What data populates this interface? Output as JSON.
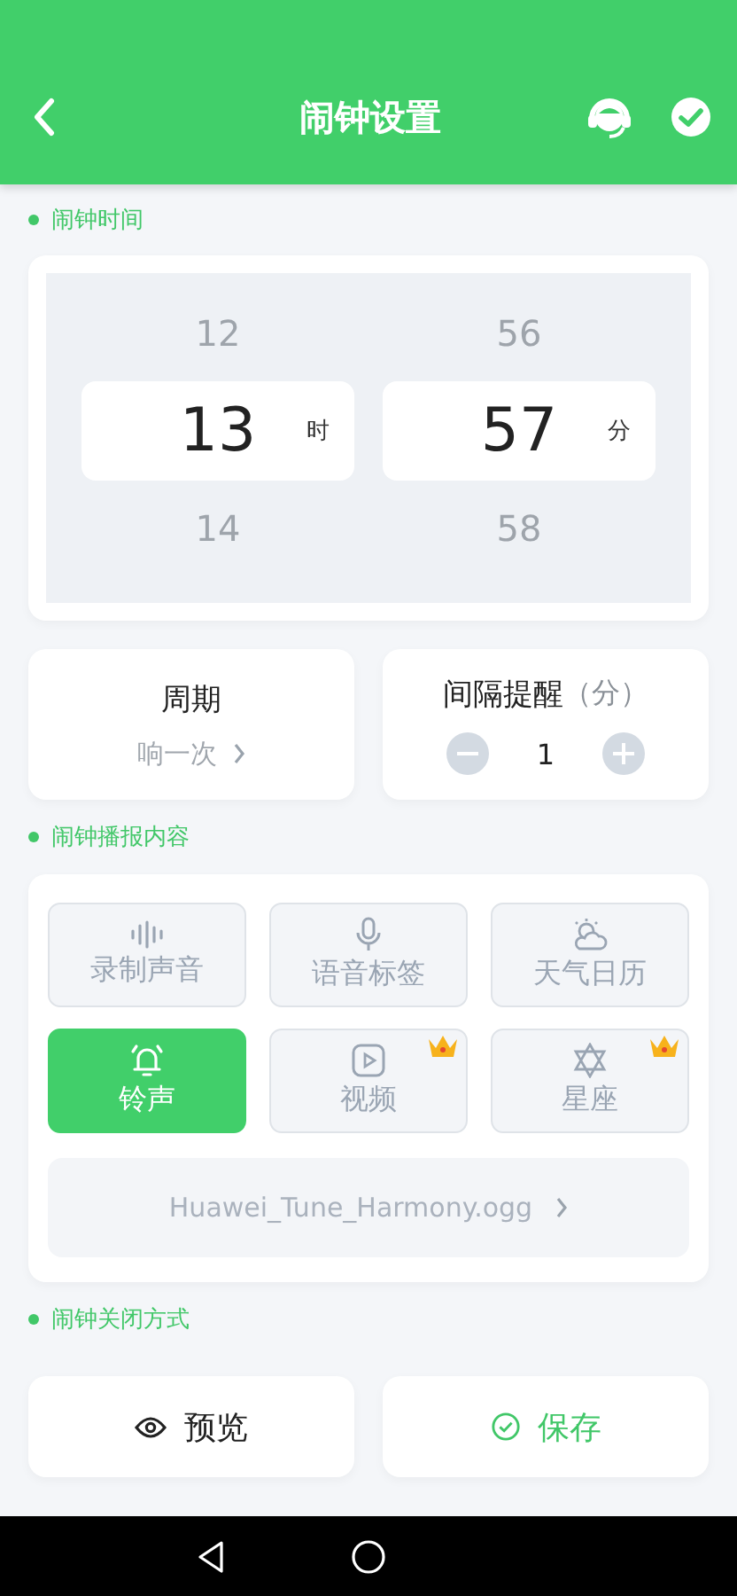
{
  "header": {
    "title": "闹钟设置"
  },
  "sections": [
    {
      "label": "闹钟时间"
    },
    {
      "label": "闹钟播报内容"
    },
    {
      "label": "闹钟关闭方式"
    }
  ],
  "picker": [
    {
      "prev": "12",
      "value": "13",
      "unit": "时",
      "next": "14"
    },
    {
      "prev": "56",
      "value": "57",
      "unit": "分",
      "next": "58"
    }
  ],
  "repeat": {
    "title": "周期",
    "value": "响一次"
  },
  "interval": {
    "title": "间隔提醒",
    "unit": "（分）",
    "value": "1"
  },
  "content_options": [
    {
      "label": "录制声音",
      "selected": false,
      "premium": false
    },
    {
      "label": "语音标签",
      "selected": false,
      "premium": false
    },
    {
      "label": "天气日历",
      "selected": false,
      "premium": false
    },
    {
      "label": "铃声",
      "selected": true,
      "premium": false
    },
    {
      "label": "视频",
      "selected": false,
      "premium": true
    },
    {
      "label": "星座",
      "selected": false,
      "premium": true
    }
  ],
  "ringtone": "Huawei_Tune_Harmony.ogg",
  "buttons": [
    {
      "kind": "preview",
      "label": "预览"
    },
    {
      "kind": "save",
      "label": "保存"
    }
  ]
}
